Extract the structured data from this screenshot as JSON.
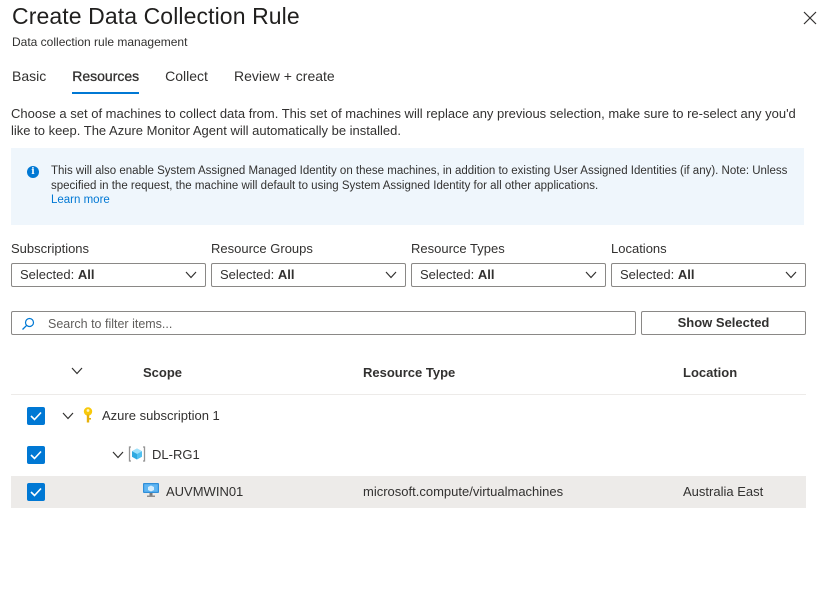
{
  "header": {
    "title": "Create Data Collection Rule",
    "subtitle": "Data collection rule management"
  },
  "tabs": [
    {
      "label": "Basic"
    },
    {
      "label": "Resources",
      "active": true
    },
    {
      "label": "Collect"
    },
    {
      "label": "Review + create"
    }
  ],
  "description": "Choose a set of machines to collect data from. This set of machines will replace any previous selection, make sure to re-select any you'd like to keep. The Azure Monitor Agent will automatically be installed.",
  "info": {
    "text": "This will also enable System Assigned Managed Identity on these machines, in addition to existing User Assigned Identities (if any). Note: Unless specified in the request, the machine will default to using System Assigned Identity for all other applications.",
    "link": "Learn more",
    "icon": "info-icon"
  },
  "filters": [
    {
      "label": "Subscriptions",
      "prefix": "Selected: ",
      "value": "All"
    },
    {
      "label": "Resource Groups",
      "prefix": "Selected: ",
      "value": "All"
    },
    {
      "label": "Resource Types",
      "prefix": "Selected: ",
      "value": "All"
    },
    {
      "label": "Locations",
      "prefix": "Selected: ",
      "value": "All"
    }
  ],
  "search": {
    "placeholder": "Search to filter items..."
  },
  "show_selected_label": "Show Selected",
  "grid": {
    "columns": [
      "Scope",
      "Resource Type",
      "Location"
    ],
    "rows": [
      {
        "scope": "Azure subscription 1",
        "resource_type": "",
        "location": "",
        "checked": true,
        "icon": "key-icon"
      },
      {
        "scope": "DL-RG1",
        "resource_type": "",
        "location": "",
        "checked": true,
        "icon": "resource-group-icon"
      },
      {
        "scope": "AUVMWIN01",
        "resource_type": "microsoft.compute/virtualmachines",
        "location": "Australia East",
        "checked": true,
        "icon": "virtual-machine-icon"
      }
    ]
  },
  "colors": {
    "accent": "#0078d4",
    "info_background": "#eff6fc",
    "selected_row": "#edebe9"
  }
}
